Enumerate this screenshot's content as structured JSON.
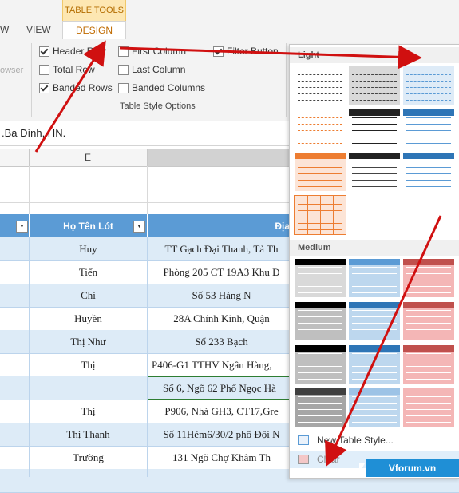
{
  "ribbon": {
    "context_label": "TABLE TOOLS",
    "tabs": {
      "view": "VIEW",
      "design": "DESIGN",
      "partial_left": "W"
    },
    "left_partial_text": "owser",
    "options": {
      "header_row": {
        "label": "Header Row",
        "checked": true
      },
      "total_row": {
        "label": "Total Row",
        "checked": false
      },
      "banded_rows": {
        "label": "Banded Rows",
        "checked": true
      },
      "first_column": {
        "label": "First Column",
        "checked": false
      },
      "last_column": {
        "label": "Last Column",
        "checked": false
      },
      "banded_columns": {
        "label": "Banded Columns",
        "checked": false
      },
      "filter_button": {
        "label": "Filter Button",
        "checked": true
      }
    },
    "group_label": "Table Style Options"
  },
  "formula_bar": {
    "value": ".Ba Đình, HN."
  },
  "grid": {
    "column_letter": "E",
    "headers": {
      "ho_ten_lot": "Họ Tên Lót",
      "dia_chi": "Địa"
    },
    "rows": [
      {
        "name": "Huy",
        "addr": "TT Gạch Đại Thanh, Tả Th"
      },
      {
        "name": "Tiến",
        "addr": "Phòng 205 CT 19A3 Khu Đ"
      },
      {
        "name": "Chi",
        "addr": "Số 53 Hàng N"
      },
      {
        "name": "Huyền",
        "addr": "28A Chính Kinh, Quận"
      },
      {
        "name": "Thị Như",
        "addr": "Số 233 Bạch"
      },
      {
        "name": "Thị",
        "addr": "P406-G1 TTHV Ngân Hàng,"
      },
      {
        "name": "",
        "addr": "Số 6, Ngõ 62 Phố Ngọc Hà"
      },
      {
        "name": "Thị",
        "addr": "P906, Nhà GH3, CT17,Gre"
      },
      {
        "name": "Thị Thanh",
        "addr": "Số 11Hẻm6/30/2 phố Đội N"
      },
      {
        "name": "Trường",
        "addr": "131 Ngõ Chợ Khâm Th"
      }
    ]
  },
  "gallery": {
    "light_label": "Light",
    "medium_label": "Medium",
    "menu": {
      "new_style": "New Table Style...",
      "clear": "Clear"
    }
  },
  "watermark": "Vforum.vn",
  "colors": {
    "accent": "#5b9bd5",
    "band": "#ddebf7",
    "arrow": "#d01010",
    "context": "#fde7b2"
  }
}
